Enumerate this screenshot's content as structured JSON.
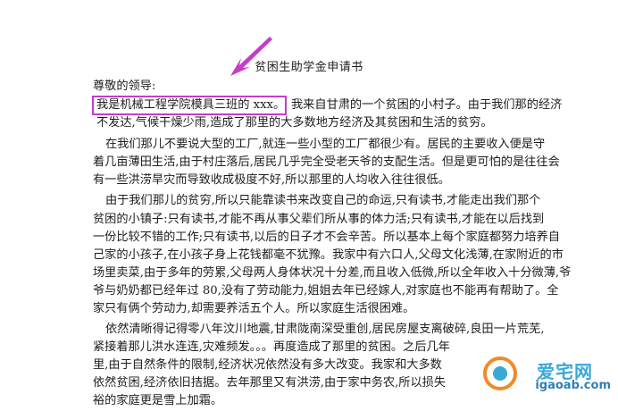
{
  "document": {
    "title": "贫困生助学金申请书",
    "salutation": "尊敬的领导:",
    "highlight": "我是机械工程学院模具三班的 xxx。",
    "lines": [
      "我来自甘肃的一个贫困的小村子。由于我们那的经济",
      "不发达,气候干燥少雨,造成了那里的大多数地方经济及其贫困和生活的贫穷。",
      "在我们那儿不要说大型的工厂,就连一些小型的工厂都很少有。居民的主要收入便是守",
      "着几亩薄田生活,由于村庄落后,居民几乎完全受老天爷的支配生活。但是更可怕的是往往会",
      "有一些洪涝旱灾而导致收成极度不好,所以那里的人均收入往往很低。",
      "由于我们那儿的贫穷,所以只能靠读书来改变自己的命运,只有读书,才能走出我们那个",
      "贫困的小镇子:只有读书,才能不再从事父辈们所从事的体力活;只有读书,才能在以后找到",
      "一份比较不错的工作;只有读书,以后的日子才不会辛苦。所以基本上每个家庭都努力培养自",
      "己家的小孩子,在小孩子身上花钱都毫不犹豫。我家中有六口人,父母文化浅薄,在家附近的市",
      "场里卖菜,由于多年的劳累,父母两人身体状况十分差,而且收入低微,所以全年收入十分微薄,爷",
      "爷与奶奶都已经年过 80,没有了劳动能力,姐姐去年已经嫁人,对家庭也不能再有帮助了。全",
      "家只有俩个劳动力,却需要养活五个人。所以家庭生活很困难。",
      "依然清晰得记得零八年汶川地震,甘肃陇南深受重创,居民房屋支离破碎,良田一片荒芜,",
      "紧接着那儿洪水连连,灾难频发。。。再度造成了那里的贫困。之后几年",
      "里,由于自然条件的限制,经济状况依然没有多大改变。我家和大多数",
      "依然贫困,经济依旧拮据。去年那里又有洪涝,由于家中务农,所以损失",
      "裕的家庭更是雪上加霜。"
    ]
  },
  "watermark": {
    "logo_text": "爱宅网",
    "url": "igaoab.com"
  }
}
